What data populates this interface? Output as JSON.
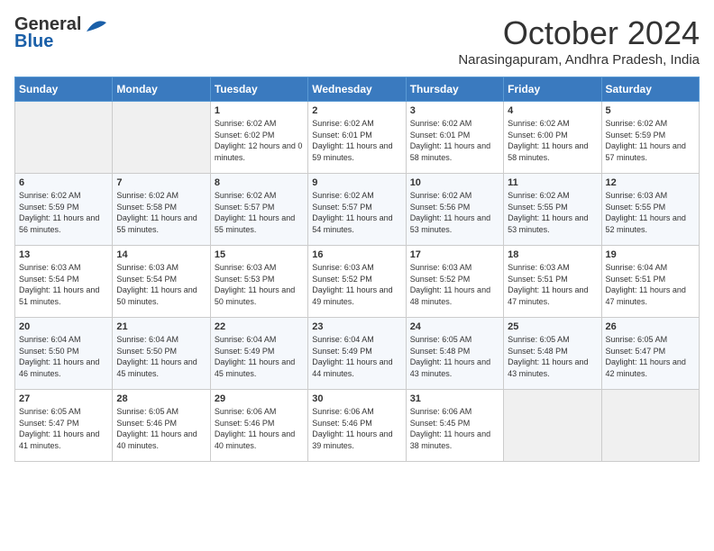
{
  "logo": {
    "line1": "General",
    "line2": "Blue"
  },
  "title": "October 2024",
  "location": "Narasingapuram, Andhra Pradesh, India",
  "weekdays": [
    "Sunday",
    "Monday",
    "Tuesday",
    "Wednesday",
    "Thursday",
    "Friday",
    "Saturday"
  ],
  "weeks": [
    [
      {
        "day": "",
        "empty": true
      },
      {
        "day": "",
        "empty": true
      },
      {
        "day": "1",
        "sunrise": "Sunrise: 6:02 AM",
        "sunset": "Sunset: 6:02 PM",
        "daylight": "Daylight: 12 hours and 0 minutes."
      },
      {
        "day": "2",
        "sunrise": "Sunrise: 6:02 AM",
        "sunset": "Sunset: 6:01 PM",
        "daylight": "Daylight: 11 hours and 59 minutes."
      },
      {
        "day": "3",
        "sunrise": "Sunrise: 6:02 AM",
        "sunset": "Sunset: 6:01 PM",
        "daylight": "Daylight: 11 hours and 58 minutes."
      },
      {
        "day": "4",
        "sunrise": "Sunrise: 6:02 AM",
        "sunset": "Sunset: 6:00 PM",
        "daylight": "Daylight: 11 hours and 58 minutes."
      },
      {
        "day": "5",
        "sunrise": "Sunrise: 6:02 AM",
        "sunset": "Sunset: 5:59 PM",
        "daylight": "Daylight: 11 hours and 57 minutes."
      }
    ],
    [
      {
        "day": "6",
        "sunrise": "Sunrise: 6:02 AM",
        "sunset": "Sunset: 5:59 PM",
        "daylight": "Daylight: 11 hours and 56 minutes."
      },
      {
        "day": "7",
        "sunrise": "Sunrise: 6:02 AM",
        "sunset": "Sunset: 5:58 PM",
        "daylight": "Daylight: 11 hours and 55 minutes."
      },
      {
        "day": "8",
        "sunrise": "Sunrise: 6:02 AM",
        "sunset": "Sunset: 5:57 PM",
        "daylight": "Daylight: 11 hours and 55 minutes."
      },
      {
        "day": "9",
        "sunrise": "Sunrise: 6:02 AM",
        "sunset": "Sunset: 5:57 PM",
        "daylight": "Daylight: 11 hours and 54 minutes."
      },
      {
        "day": "10",
        "sunrise": "Sunrise: 6:02 AM",
        "sunset": "Sunset: 5:56 PM",
        "daylight": "Daylight: 11 hours and 53 minutes."
      },
      {
        "day": "11",
        "sunrise": "Sunrise: 6:02 AM",
        "sunset": "Sunset: 5:55 PM",
        "daylight": "Daylight: 11 hours and 53 minutes."
      },
      {
        "day": "12",
        "sunrise": "Sunrise: 6:03 AM",
        "sunset": "Sunset: 5:55 PM",
        "daylight": "Daylight: 11 hours and 52 minutes."
      }
    ],
    [
      {
        "day": "13",
        "sunrise": "Sunrise: 6:03 AM",
        "sunset": "Sunset: 5:54 PM",
        "daylight": "Daylight: 11 hours and 51 minutes."
      },
      {
        "day": "14",
        "sunrise": "Sunrise: 6:03 AM",
        "sunset": "Sunset: 5:54 PM",
        "daylight": "Daylight: 11 hours and 50 minutes."
      },
      {
        "day": "15",
        "sunrise": "Sunrise: 6:03 AM",
        "sunset": "Sunset: 5:53 PM",
        "daylight": "Daylight: 11 hours and 50 minutes."
      },
      {
        "day": "16",
        "sunrise": "Sunrise: 6:03 AM",
        "sunset": "Sunset: 5:52 PM",
        "daylight": "Daylight: 11 hours and 49 minutes."
      },
      {
        "day": "17",
        "sunrise": "Sunrise: 6:03 AM",
        "sunset": "Sunset: 5:52 PM",
        "daylight": "Daylight: 11 hours and 48 minutes."
      },
      {
        "day": "18",
        "sunrise": "Sunrise: 6:03 AM",
        "sunset": "Sunset: 5:51 PM",
        "daylight": "Daylight: 11 hours and 47 minutes."
      },
      {
        "day": "19",
        "sunrise": "Sunrise: 6:04 AM",
        "sunset": "Sunset: 5:51 PM",
        "daylight": "Daylight: 11 hours and 47 minutes."
      }
    ],
    [
      {
        "day": "20",
        "sunrise": "Sunrise: 6:04 AM",
        "sunset": "Sunset: 5:50 PM",
        "daylight": "Daylight: 11 hours and 46 minutes."
      },
      {
        "day": "21",
        "sunrise": "Sunrise: 6:04 AM",
        "sunset": "Sunset: 5:50 PM",
        "daylight": "Daylight: 11 hours and 45 minutes."
      },
      {
        "day": "22",
        "sunrise": "Sunrise: 6:04 AM",
        "sunset": "Sunset: 5:49 PM",
        "daylight": "Daylight: 11 hours and 45 minutes."
      },
      {
        "day": "23",
        "sunrise": "Sunrise: 6:04 AM",
        "sunset": "Sunset: 5:49 PM",
        "daylight": "Daylight: 11 hours and 44 minutes."
      },
      {
        "day": "24",
        "sunrise": "Sunrise: 6:05 AM",
        "sunset": "Sunset: 5:48 PM",
        "daylight": "Daylight: 11 hours and 43 minutes."
      },
      {
        "day": "25",
        "sunrise": "Sunrise: 6:05 AM",
        "sunset": "Sunset: 5:48 PM",
        "daylight": "Daylight: 11 hours and 43 minutes."
      },
      {
        "day": "26",
        "sunrise": "Sunrise: 6:05 AM",
        "sunset": "Sunset: 5:47 PM",
        "daylight": "Daylight: 11 hours and 42 minutes."
      }
    ],
    [
      {
        "day": "27",
        "sunrise": "Sunrise: 6:05 AM",
        "sunset": "Sunset: 5:47 PM",
        "daylight": "Daylight: 11 hours and 41 minutes."
      },
      {
        "day": "28",
        "sunrise": "Sunrise: 6:05 AM",
        "sunset": "Sunset: 5:46 PM",
        "daylight": "Daylight: 11 hours and 40 minutes."
      },
      {
        "day": "29",
        "sunrise": "Sunrise: 6:06 AM",
        "sunset": "Sunset: 5:46 PM",
        "daylight": "Daylight: 11 hours and 40 minutes."
      },
      {
        "day": "30",
        "sunrise": "Sunrise: 6:06 AM",
        "sunset": "Sunset: 5:46 PM",
        "daylight": "Daylight: 11 hours and 39 minutes."
      },
      {
        "day": "31",
        "sunrise": "Sunrise: 6:06 AM",
        "sunset": "Sunset: 5:45 PM",
        "daylight": "Daylight: 11 hours and 38 minutes."
      },
      {
        "day": "",
        "empty": true
      },
      {
        "day": "",
        "empty": true
      }
    ]
  ]
}
